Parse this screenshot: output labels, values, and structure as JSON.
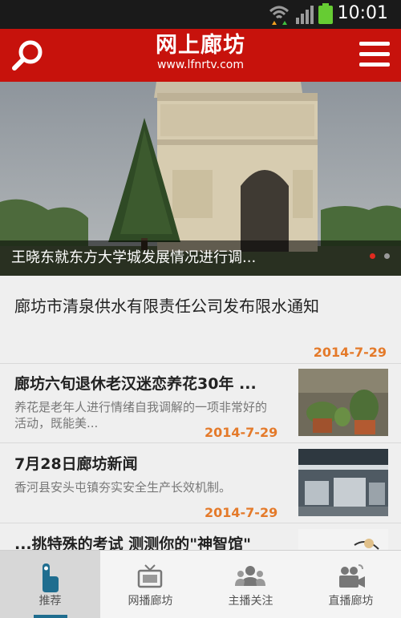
{
  "statusbar": {
    "time": "10:01"
  },
  "appbar": {
    "title": "网上廊坊",
    "url": "www.lfnrtv.com"
  },
  "hero": {
    "caption": "王晓东就东方大学城发展情况进行调...",
    "dots": [
      {
        "active": true
      },
      {
        "active": false
      }
    ]
  },
  "articles": {
    "top": {
      "title": "廊坊市清泉供水有限责任公司发布限水通知",
      "date": "2014-7-29"
    },
    "items": [
      {
        "title": "廊坊六旬退休老汉迷恋养花30年 ...",
        "summary": "养花是老年人进行情绪自我调解的一项非常好的活动，既能美...",
        "date": "2014-7-29"
      },
      {
        "title": "7月28日廊坊新闻",
        "summary": "香河县安头屯镇夯实安全生产长效机制。",
        "date": "2014-7-29"
      },
      {
        "title": "...挑特殊的考试 测测你的\"神智馆\"",
        "summary": "",
        "date": ""
      }
    ]
  },
  "tabs": [
    {
      "label": "推荐",
      "icon": "hand-tap-icon",
      "active": true
    },
    {
      "label": "网播廊坊",
      "icon": "tv-icon",
      "active": false
    },
    {
      "label": "主播关注",
      "icon": "people-icon",
      "active": false
    },
    {
      "label": "直播廊坊",
      "icon": "video-camera-icon",
      "active": false
    }
  ],
  "colors": {
    "brand_red": "#c7120c",
    "date_orange": "#e47a2a",
    "tab_active_bg": "#d7d7d7"
  }
}
